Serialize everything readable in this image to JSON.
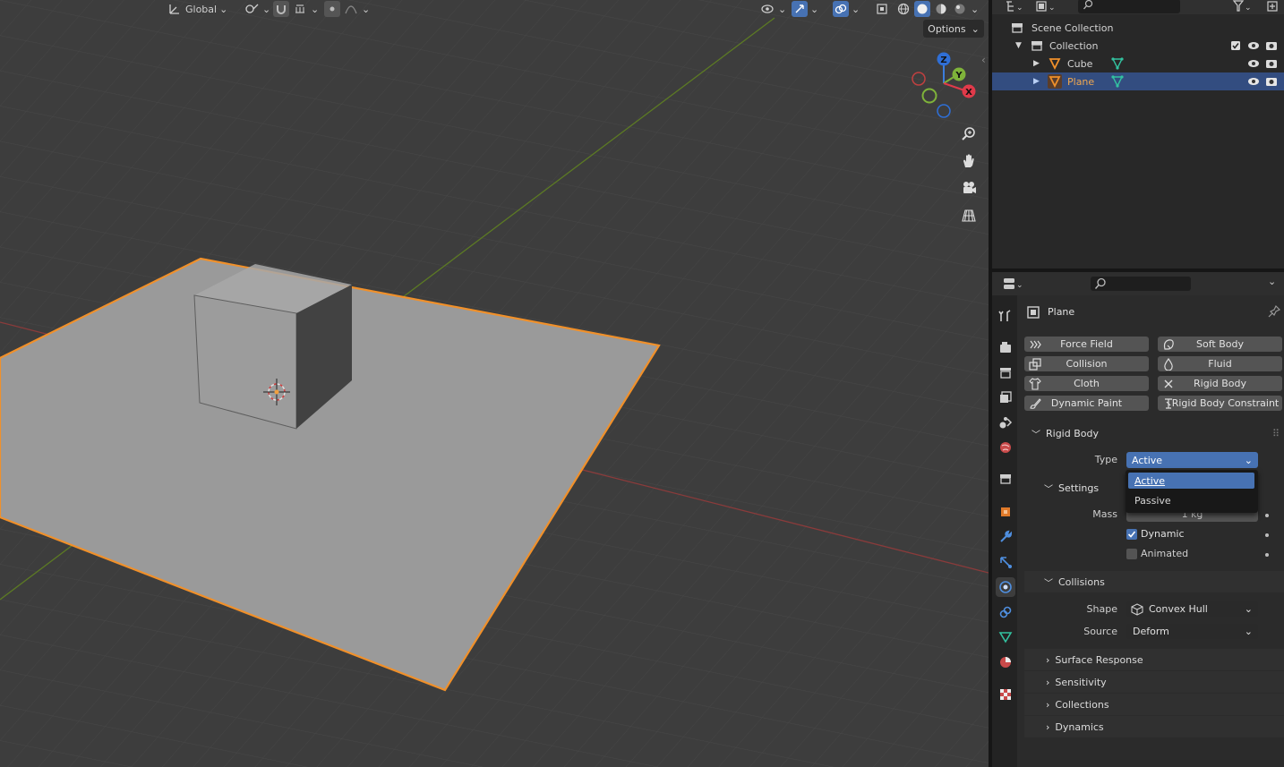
{
  "viewport": {
    "header": {
      "transform_orientation": "Global",
      "options_label": "Options"
    },
    "gizmo": {
      "z": "Z",
      "y": "Y",
      "x": "X"
    },
    "colors": {
      "selected_outline": "#f0902a",
      "x_axis": "#b34a4a",
      "y_axis": "#6c8f2a",
      "plane": "#9b9b9b",
      "cube_side": "#434343"
    }
  },
  "outliner": {
    "scene_collection": "Scene Collection",
    "collection": "Collection",
    "objects": [
      {
        "name": "Cube",
        "selected": false
      },
      {
        "name": "Plane",
        "selected": true
      }
    ]
  },
  "properties": {
    "object_name": "Plane",
    "physics_buttons": {
      "force_field": "Force Field",
      "soft_body": "Soft Body",
      "collision": "Collision",
      "fluid": "Fluid",
      "cloth": "Cloth",
      "rigid_body": "Rigid Body",
      "dynamic_paint": "Dynamic Paint",
      "rigid_body_constraint": "Rigid Body Constraint"
    },
    "rigid_body_panel": {
      "title": "Rigid Body",
      "type_label": "Type",
      "type_value": "Active",
      "type_options": [
        "Active",
        "Passive"
      ],
      "settings": {
        "title": "Settings",
        "mass_label": "Mass",
        "mass_value": "1 kg",
        "dynamic_label": "Dynamic",
        "dynamic_checked": true,
        "animated_label": "Animated",
        "animated_checked": false
      },
      "collisions": {
        "title": "Collisions",
        "shape_label": "Shape",
        "shape_value": "Convex Hull",
        "source_label": "Source",
        "source_value": "Deform"
      },
      "subpanels": [
        "Surface Response",
        "Sensitivity",
        "Collections",
        "Dynamics"
      ]
    }
  }
}
